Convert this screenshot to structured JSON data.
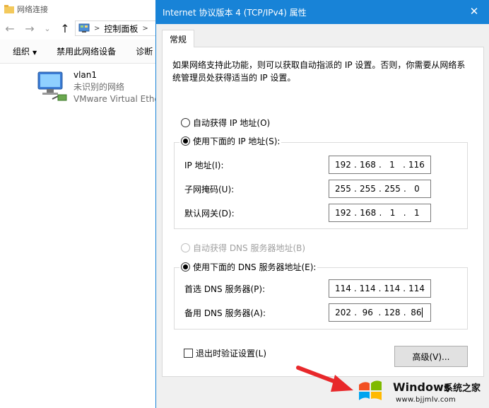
{
  "explorer": {
    "title": "网络连接",
    "nav": {
      "back": "←",
      "forward": "→",
      "dropdown": "⌄",
      "up": "↑"
    },
    "address": {
      "path": "控制面板",
      "separator": ">"
    },
    "toolbar": {
      "organize": "组织",
      "organize_caret": "▼",
      "disable": "禁用此网络设备",
      "diagnose": "诊断"
    },
    "adapter": {
      "name": "vlan1",
      "status": "未识别的网络",
      "device": "VMware Virtual Ethe"
    }
  },
  "dialog": {
    "title": "Internet 协议版本 4 (TCP/IPv4) 属性",
    "close": "✕",
    "tab": "常规",
    "intro": "如果网络支持此功能，则可以获取自动指派的 IP 设置。否则，你需要从网络系统管理员处获得适当的 IP 设置。",
    "ip_auto": "自动获得 IP 地址(O)",
    "ip_manual": "使用下面的 IP 地址(S):",
    "ip_fields": [
      {
        "label": "IP 地址(I):",
        "octets": [
          "192",
          "168",
          "1",
          "116"
        ]
      },
      {
        "label": "子网掩码(U):",
        "octets": [
          "255",
          "255",
          "255",
          "0"
        ]
      },
      {
        "label": "默认网关(D):",
        "octets": [
          "192",
          "168",
          "1",
          "1"
        ]
      }
    ],
    "dns_auto": "自动获得 DNS 服务器地址(B)",
    "dns_manual": "使用下面的 DNS 服务器地址(E):",
    "dns_fields": [
      {
        "label": "首选 DNS 服务器(P):",
        "octets": [
          "114",
          "114",
          "114",
          "114"
        ]
      },
      {
        "label": "备用 DNS 服务器(A):",
        "octets": [
          "202",
          "96",
          "128",
          "86"
        ]
      }
    ],
    "validate": "退出时验证设置(L)",
    "advanced": "高级(V)...",
    "colors": {
      "titlebar": "#1883d7",
      "background": "#f0f0f0"
    }
  },
  "watermark": {
    "brand": "Windows",
    "site": "系统之家",
    "url": "www.bjjmlv.com"
  },
  "arrow": {
    "color": "#e8282b"
  }
}
